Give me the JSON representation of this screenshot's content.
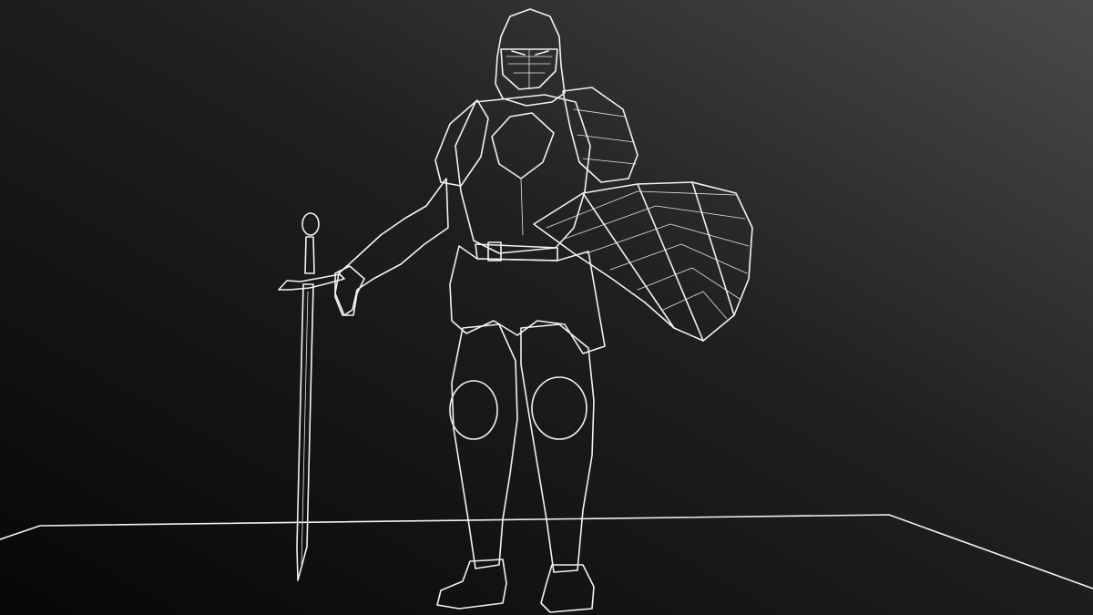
{
  "scene": {
    "render_mode": "wireframe",
    "background_colors": [
      "#070707",
      "#4a4a4a"
    ],
    "wire_color": "#f2f2f2",
    "objects": [
      "knight-armor",
      "helmet",
      "sword",
      "kite-shield",
      "ground-plane"
    ]
  }
}
